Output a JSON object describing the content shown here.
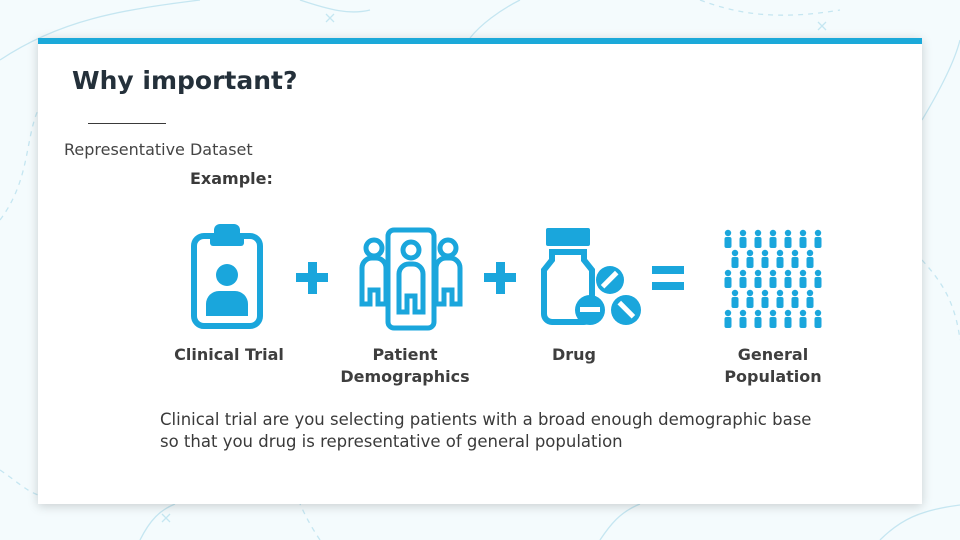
{
  "slide": {
    "title": "Why important?",
    "subtitle": "Representative Dataset",
    "example_label": "Example:",
    "equation": {
      "items": [
        {
          "icon": "clipboard-person-icon",
          "line1": "Clinical Trial",
          "line2": ""
        },
        {
          "icon": "patient-group-icon",
          "line1": "Patient",
          "line2": "Demographics"
        },
        {
          "icon": "drug-bottle-pills-icon",
          "line1": "Drug",
          "line2": ""
        },
        {
          "icon": "population-crowd-icon",
          "line1": "General",
          "line2": "Population"
        }
      ],
      "operators": [
        "+",
        "+",
        "="
      ]
    },
    "description": {
      "line1": "Clinical trial are you selecting patients with a broad enough demographic base",
      "line2": "so that you drug is representative of general population"
    }
  },
  "colors": {
    "accent": "#1ba9d9",
    "icon": "#1aa6dc",
    "title": "#24303a",
    "text": "#3a3a3a"
  }
}
